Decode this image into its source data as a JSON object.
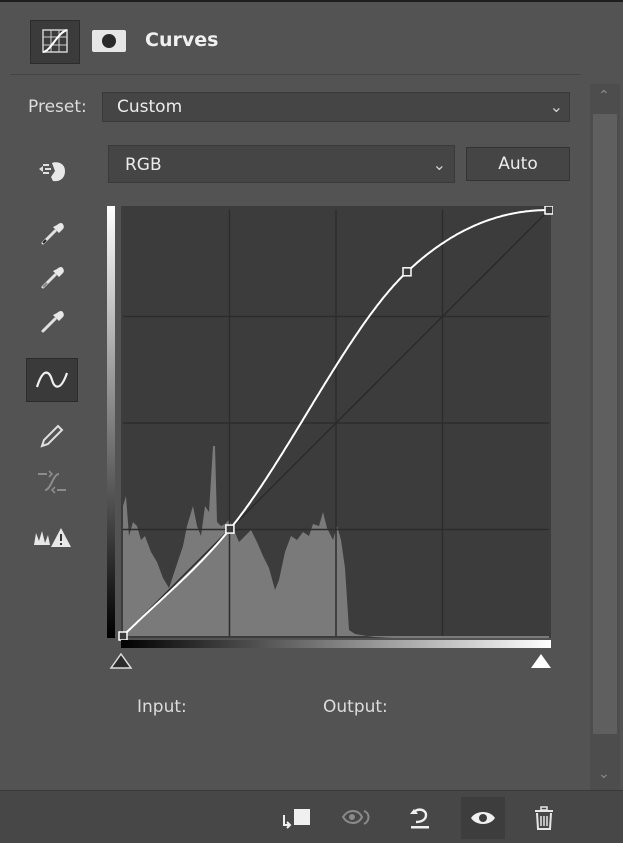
{
  "panel": {
    "title": "Curves"
  },
  "preset": {
    "label": "Preset:",
    "value": "Custom"
  },
  "channel": {
    "value": "RGB"
  },
  "auto_button": {
    "label": "Auto"
  },
  "readouts": {
    "input_label": "Input:",
    "output_label": "Output:"
  },
  "curve": {
    "points": [
      [
        0,
        0
      ],
      [
        64,
        64
      ],
      [
        170,
        218
      ],
      [
        255,
        255
      ]
    ]
  },
  "icons": {
    "header": [
      "adjustment-layer-curves-icon",
      "layer-mask-icon"
    ],
    "tools": [
      "targeted-adjustment-hand-icon",
      "sample-black-point-eyedropper-icon",
      "sample-gray-point-eyedropper-icon",
      "sample-white-point-eyedropper-icon",
      "edit-points-curve-icon",
      "draw-pencil-icon",
      "smooth-curve-icon",
      "clipping-warning-icon"
    ],
    "footer": [
      "clip-to-layer-icon",
      "view-previous-state-icon",
      "reset-defaults-icon",
      "toggle-visibility-icon",
      "delete-icon"
    ]
  },
  "colors": {
    "panel_bg": "#535353",
    "graph_bg": "#3c3c3c",
    "histogram": "#7a7a7a",
    "curve": "#ffffff"
  }
}
